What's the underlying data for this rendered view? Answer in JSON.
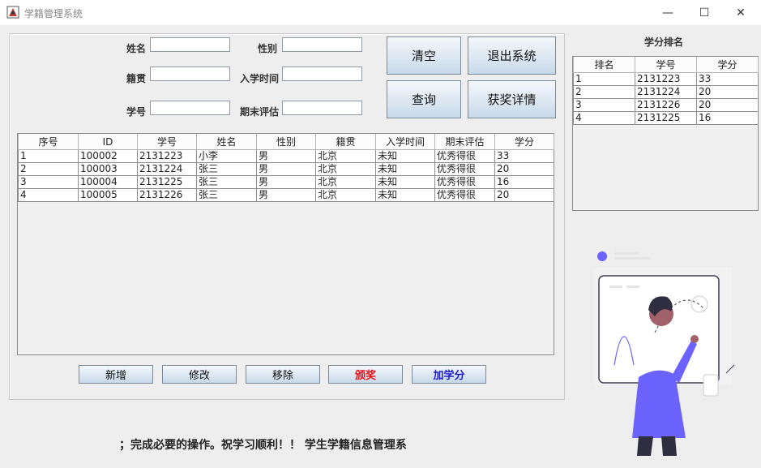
{
  "window": {
    "title": "学籍管理系统",
    "minimize": "—",
    "maximize": "☐",
    "close": "✕"
  },
  "form": {
    "name_label": "姓名",
    "gender_label": "性别",
    "origin_label": "籍贯",
    "enroll_label": "入学时间",
    "student_no_label": "学号",
    "final_label": "期末评估",
    "name_value": "",
    "gender_value": "",
    "origin_value": "",
    "enroll_value": "",
    "student_no_value": "",
    "final_value": ""
  },
  "buttons": {
    "clear": "清空",
    "exit": "退出系统",
    "query": "查询",
    "award_detail": "获奖详情",
    "add": "新增",
    "edit": "修改",
    "remove": "移除",
    "award": "颁奖",
    "add_credit": "加学分"
  },
  "colors": {
    "award_text": "#e8101a",
    "credit_text": "#1a1acc"
  },
  "main_table": {
    "columns": [
      "序号",
      "ID",
      "学号",
      "姓名",
      "性别",
      "籍贯",
      "入学时间",
      "期末评估",
      "学分"
    ],
    "rows": [
      [
        "1",
        "100002",
        "2131223",
        "小李",
        "男",
        "北京",
        "未知",
        "优秀得很",
        "33"
      ],
      [
        "2",
        "100003",
        "2131224",
        "张三",
        "男",
        "北京",
        "未知",
        "优秀得很",
        "20"
      ],
      [
        "3",
        "100004",
        "2131225",
        "张三",
        "男",
        "北京",
        "未知",
        "优秀得很",
        "16"
      ],
      [
        "4",
        "100005",
        "2131226",
        "张三",
        "男",
        "北京",
        "未知",
        "优秀得很",
        "20"
      ]
    ]
  },
  "ranking": {
    "title": "学分排名",
    "columns": [
      "排名",
      "学号",
      "学分"
    ],
    "rows": [
      [
        "1",
        "2131223",
        "33"
      ],
      [
        "2",
        "2131224",
        "20"
      ],
      [
        "3",
        "2131226",
        "20"
      ],
      [
        "4",
        "2131225",
        "16"
      ]
    ]
  },
  "marquee": {
    "text": "；完成必要的操作。祝学习顺利！！ 学生学籍信息管理系"
  }
}
